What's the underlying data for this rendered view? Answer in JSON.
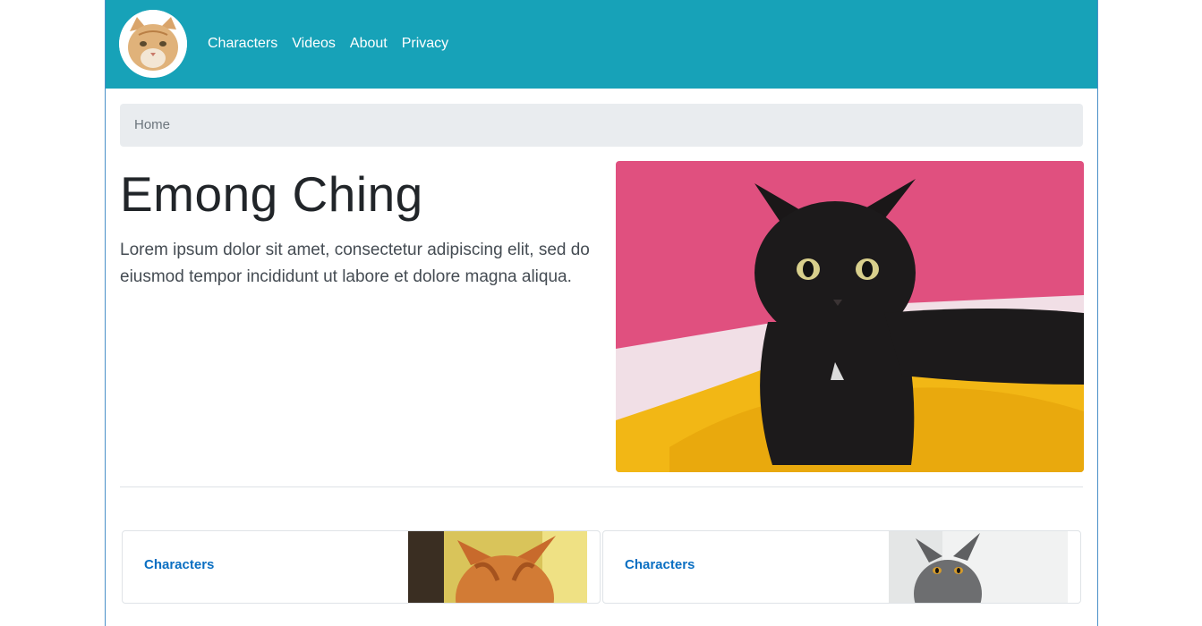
{
  "navbar": {
    "logo_alt": "cat logo",
    "links": [
      "Characters",
      "Videos",
      "About",
      "Privacy"
    ],
    "background": "#17a2b8"
  },
  "breadcrumb": {
    "items": [
      "Home"
    ]
  },
  "hero": {
    "title": "Emong Ching",
    "text": "Lorem ipsum dolor sit amet, consectetur adipiscing elit, sed do eiusmod tempor incididunt ut labore et dolore magna aliqua.",
    "image_subject": "black cat on yellow blanket"
  },
  "cards": [
    {
      "title": "Characters",
      "image_subject": "orange tabby cat"
    },
    {
      "title": "Characters",
      "image_subject": "grey british shorthair cat"
    }
  ]
}
